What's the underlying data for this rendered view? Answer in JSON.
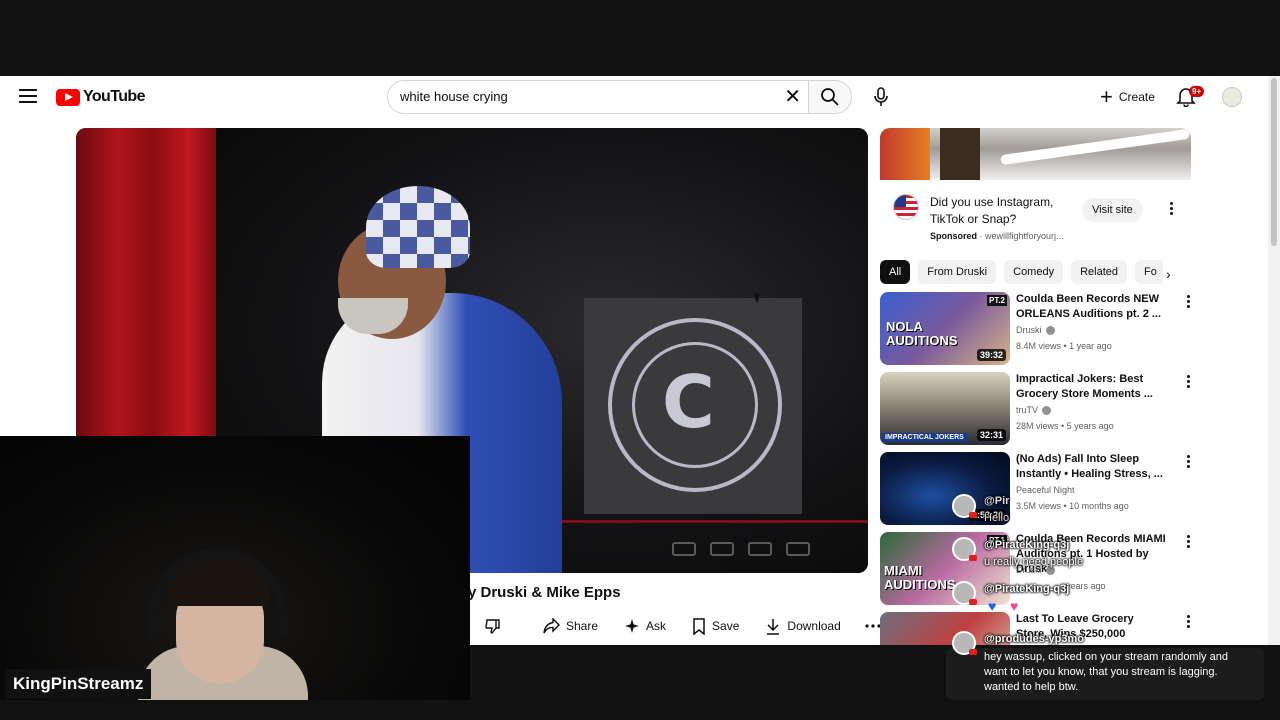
{
  "masthead": {
    "logo_text": "YouTube",
    "search": {
      "value": "white house crying",
      "placeholder": "Search"
    },
    "create_label": "Create",
    "notification_badge": "9+"
  },
  "video": {
    "title_partial": "y Druski & Mike Epps",
    "sign_letter": "C",
    "actions": {
      "share": "Share",
      "ask": "Ask",
      "save": "Save",
      "download": "Download"
    }
  },
  "ad": {
    "title": "Did you use Instagram, TikTok or Snap?",
    "sponsored": "Sponsored",
    "domain": "wewillfightforyourj...",
    "visit_label": "Visit site"
  },
  "chips": [
    "All",
    "From Druski",
    "Comedy",
    "Related",
    "Fo"
  ],
  "recommendations": [
    {
      "title": "Coulda Been Records NEW ORLEANS Auditions pt. 2 ...",
      "channel": "Druski",
      "verified": true,
      "meta": "8.4M views • 1 year ago",
      "duration": "39:32",
      "thumb_text": "NOLA AUDITIONS",
      "badge": "PT.2"
    },
    {
      "title": "Impractical Jokers: Best Grocery Store Moments ...",
      "channel": "truTV",
      "verified": true,
      "meta": "28M views • 5 years ago",
      "duration": "32:31",
      "thumb_text": "IMPRACTICAL JOKERS"
    },
    {
      "title": "(No Ads) Fall Into Sleep Instantly • Healing Stress, ...",
      "channel": "Peaceful Night",
      "verified": false,
      "meta": "3.5M views • 10 months ago",
      "duration": "2:53:20"
    },
    {
      "title": "Coulda Been Records MIAMI Auditions pt. 1 Hosted by Druski",
      "channel": "Druski",
      "verified": true,
      "meta": "years ago",
      "thumb_text": "MIAMI AUDITIONS",
      "badge": "PT.1"
    },
    {
      "title": "Last To Leave Grocery Store, Wins $250,000",
      "channel": "",
      "verified": false,
      "meta": ""
    }
  ],
  "stream": {
    "streamer_name": "KingPinStreamz",
    "chat": [
      {
        "user": "@Pir",
        "message": "Hello"
      },
      {
        "user": "@PirateKing-q3j",
        "message": "u really need people"
      },
      {
        "user": "@PirateKing-q3j",
        "message": ""
      },
      {
        "user": "@produdes-yp3mo",
        "message": "hey wassup, clicked on your stream randomly and want to let you know, that you stream is lagging. wanted to help btw."
      }
    ]
  },
  "colors": {
    "youtube_red": "#ff0000",
    "page_bg": "#ffffff",
    "frame_bg": "#111111",
    "chip_active_bg": "#0f0f0f"
  }
}
